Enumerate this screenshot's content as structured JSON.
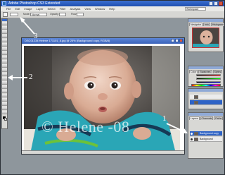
{
  "app": {
    "title": "Adobe Photoshop CS3 Extended",
    "menus": [
      "File",
      "Edit",
      "Image",
      "Layer",
      "Select",
      "Filter",
      "Analysis",
      "View",
      "Window",
      "Help"
    ],
    "workspace": "Workspace"
  },
  "options_bar": {
    "mode_label": "Mode:",
    "mode_value": "Normal",
    "opacity_label": "Opacity:",
    "flow_label": "Flow:"
  },
  "document": {
    "title": "DSC01234 Helene 171101_8.jpg @ 25% (Background copy, RGB/8)",
    "watermark": "© Helene -08"
  },
  "panels": {
    "navigator_tabs": [
      "Navigator",
      "Info",
      "Histogram"
    ],
    "color_tabs": [
      "Color",
      "Swatches",
      "Styles"
    ],
    "layers_tabs": [
      "Layers",
      "Channels",
      "Paths"
    ],
    "layers": [
      {
        "name": "Background copy",
        "selected": true
      },
      {
        "name": "Background",
        "selected": false
      }
    ]
  },
  "annotations": {
    "labels": [
      "1",
      "2",
      "3"
    ],
    "arrow_color": "#ffffff"
  },
  "colors": {
    "title_bar": "#2b5cc4",
    "selected_layer": "#2e63c6",
    "workspace_bg": "#8e969c"
  }
}
